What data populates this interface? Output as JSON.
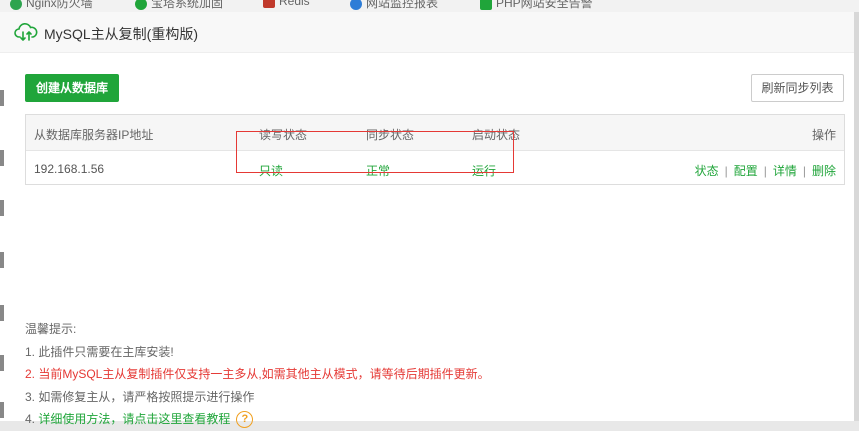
{
  "background_tabs": [
    {
      "label": "Nginx防火墙",
      "color": "#2ea44f"
    },
    {
      "label": "宝塔系统加固",
      "color": "#20a53a"
    },
    {
      "label": "Redis",
      "color": "#c0392b"
    },
    {
      "label": "网站监控报表",
      "color": "#2e7dd7"
    },
    {
      "label": "PHP网站安全告警",
      "color": "#20a53a"
    }
  ],
  "dialog": {
    "title": "MySQL主从复制(重构版)",
    "title_icon": "cloud-sync-icon"
  },
  "toolbar": {
    "create_label": "创建从数据库",
    "refresh_label": "刷新同步列表"
  },
  "table": {
    "headers": {
      "ip": "从数据库服务器IP地址",
      "rw": "读写状态",
      "sync": "同步状态",
      "run": "启动状态",
      "ops": "操作"
    },
    "rows": [
      {
        "ip": "192.168.1.56",
        "rw": "只读",
        "sync": "正常",
        "run": "运行",
        "ops": [
          "状态",
          "配置",
          "详情",
          "删除"
        ]
      }
    ]
  },
  "tips": {
    "heading": "温馨提示:",
    "line1": "1. 此插件只需要在主库安装!",
    "line2": "2. 当前MySQL主从复制插件仅支持一主多从,如需其他主从模式，请等待后期插件更新。",
    "line3": "3. 如需修复主从，请严格按照提示进行操作",
    "line4_prefix": "4. ",
    "line4_link": "详细使用方法，请点击这里查看教程",
    "help_glyph": "?"
  },
  "colors": {
    "accent": "#20a53a",
    "warning": "#e53935",
    "help": "#f0a020"
  }
}
